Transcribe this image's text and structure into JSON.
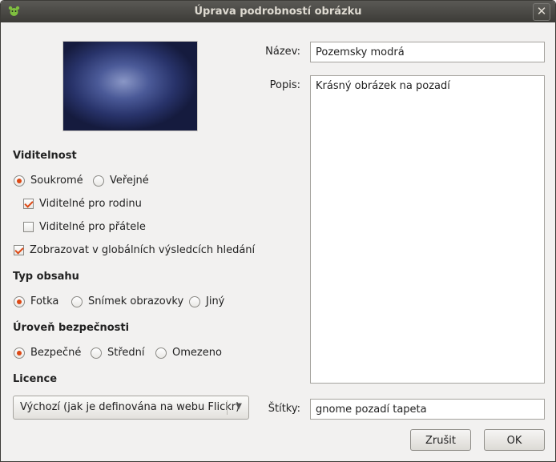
{
  "window": {
    "title": "Úprava podrobností obrázku",
    "close_glyph": "✕"
  },
  "visibility": {
    "heading": "Viditelnost",
    "private_label": "Soukromé",
    "public_label": "Veřejné",
    "family_label": "Viditelné pro rodinu",
    "friends_label": "Viditelné pro přátele",
    "global_search_label": "Zobrazovat v globálních výsledcích hledání",
    "selected": "private",
    "family_checked": true,
    "friends_checked": false,
    "global_search_checked": true
  },
  "content_type": {
    "heading": "Typ obsahu",
    "options": [
      "Fotka",
      "Snímek obrazovky",
      "Jiný"
    ],
    "selected": "Fotka"
  },
  "safety": {
    "heading": "Úroveň bezpečnosti",
    "options": [
      "Bezpečné",
      "Střední",
      "Omezeno"
    ],
    "selected": "Bezpečné"
  },
  "license": {
    "heading": "Licence",
    "selected": "Výchozí (jak je definována na webu Flickr)"
  },
  "fields": {
    "name_label": "Název:",
    "name_value": "Pozemsky modrá",
    "description_label": "Popis:",
    "description_value": "Krásný obrázek na pozadí",
    "tags_label": "Štítky:",
    "tags_value": "gnome pozadí tapeta"
  },
  "buttons": {
    "cancel": "Zrušit",
    "ok": "OK"
  },
  "colors": {
    "accent": "#dd4814",
    "titlebar": "#3c3b37"
  }
}
